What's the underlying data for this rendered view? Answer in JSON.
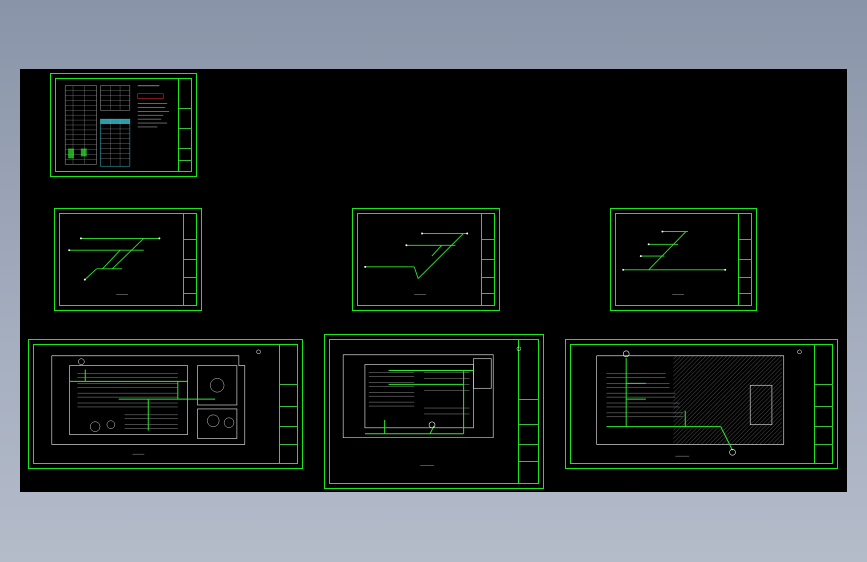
{
  "app": {
    "background_gradient": [
      "#8a94a8",
      "#b4bcca"
    ],
    "canvas_color": "#000000"
  },
  "colors": {
    "frame": "#19e619",
    "pipe": "#2ee82e",
    "wall": "#d0d0d0",
    "hatch": "#808080",
    "text": "#cccccc",
    "marker": "#ffffff",
    "red_note": "#ff3030",
    "table_cyan": "#35c4d8"
  },
  "sheets": [
    {
      "id": "sheet-legend",
      "kind": "legend-table"
    },
    {
      "id": "sheet-iso-1",
      "kind": "isometric"
    },
    {
      "id": "sheet-iso-2",
      "kind": "isometric"
    },
    {
      "id": "sheet-iso-3",
      "kind": "isometric"
    },
    {
      "id": "sheet-plan-1",
      "kind": "floor-plan"
    },
    {
      "id": "sheet-plan-2",
      "kind": "floor-plan"
    },
    {
      "id": "sheet-plan-3",
      "kind": "floor-plan"
    }
  ]
}
